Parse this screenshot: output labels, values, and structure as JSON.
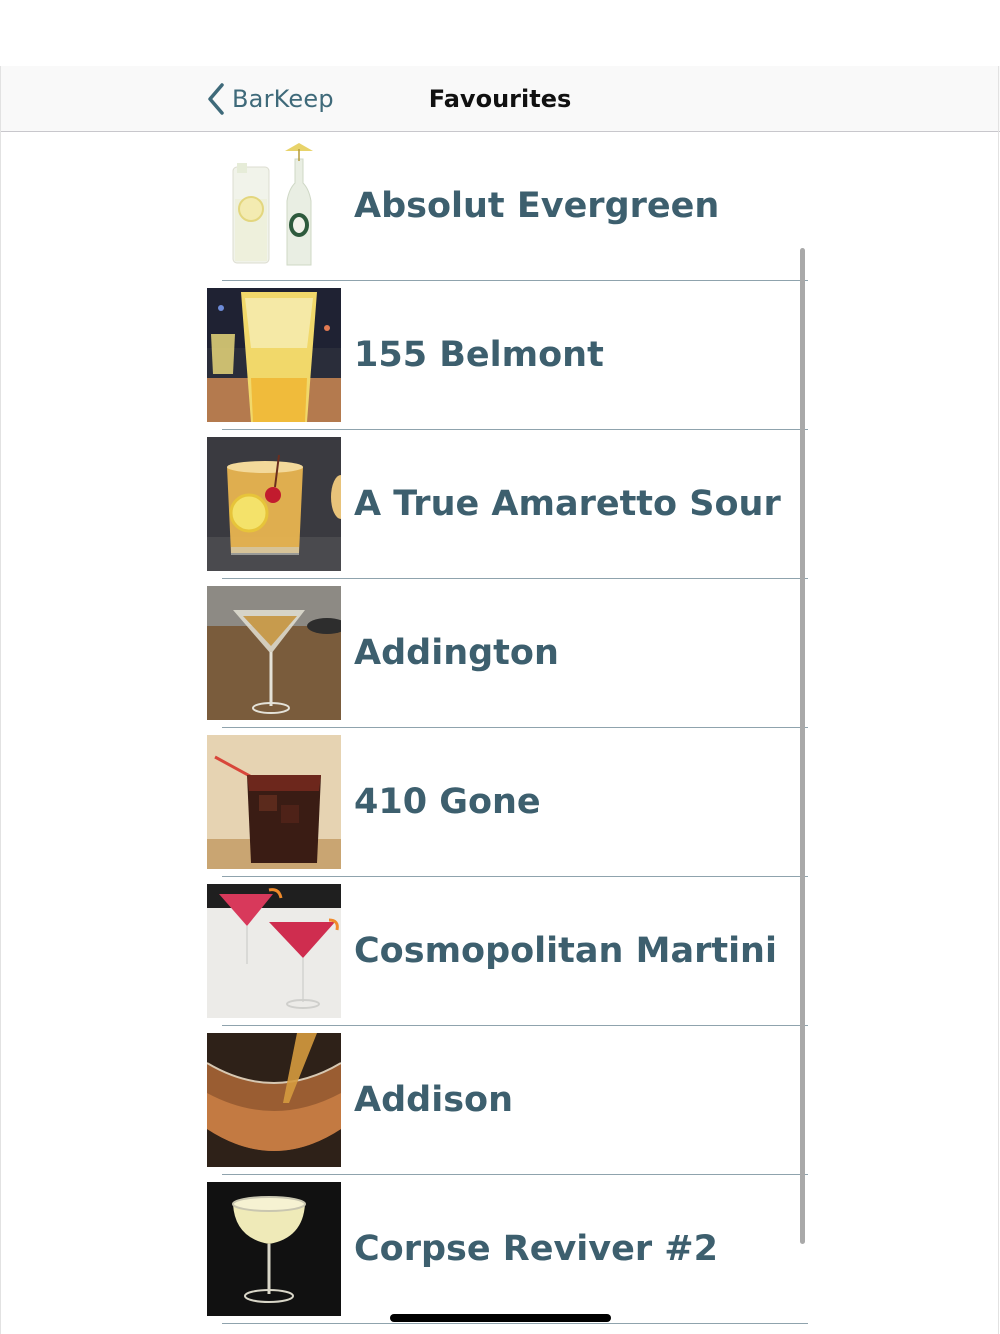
{
  "nav": {
    "back_label": "BarKeep",
    "title": "Favourites"
  },
  "colors": {
    "accent": "#3f6a7a",
    "row_text": "#3d5f6e",
    "separator": "#8fa3ad"
  },
  "favourites": [
    {
      "name": "Absolut Evergreen",
      "image": "highball-glass-with-lemon-and-bottle-thumbnail"
    },
    {
      "name": "155 Belmont",
      "image": "tall-yellow-cocktail-thumbnail"
    },
    {
      "name": "A True Amaretto Sour",
      "image": "amaretto-sour-rocks-glass-thumbnail"
    },
    {
      "name": "Addington",
      "image": "martini-glass-cocktail-thumbnail"
    },
    {
      "name": "410 Gone",
      "image": "dark-cocktail-rocks-glass-thumbnail"
    },
    {
      "name": "Cosmopolitan Martini",
      "image": "two-pink-martini-glasses-thumbnail"
    },
    {
      "name": "Addison",
      "image": "amber-cocktail-pour-thumbnail"
    },
    {
      "name": "Corpse Reviver #2",
      "image": "coupe-glass-cocktail-thumbnail"
    }
  ]
}
